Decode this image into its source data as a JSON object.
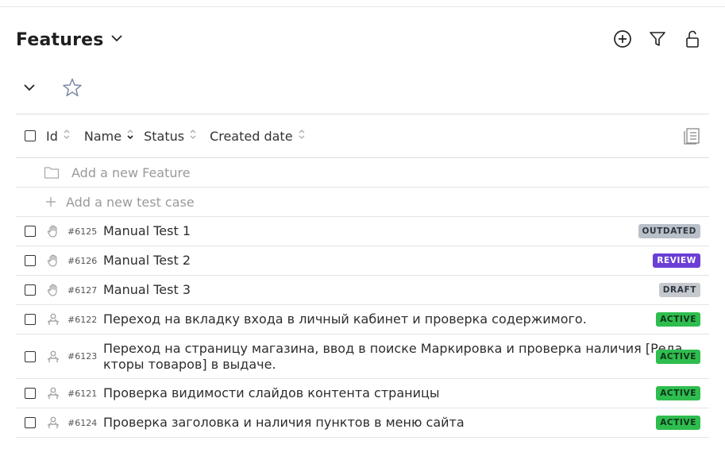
{
  "header": {
    "title": "Features",
    "icons": [
      "chevron-down-icon",
      "plus-circle-icon",
      "filter-icon",
      "unlock-icon"
    ]
  },
  "toolbar": {
    "icons": [
      "chevron-down-icon",
      "star-icon"
    ]
  },
  "table": {
    "columns": [
      "Id",
      "Name",
      "Status",
      "Created date"
    ],
    "add_feature_label": "Add a new Feature",
    "add_test_case_label": "Add a new test case",
    "rows": [
      {
        "id": "#6125",
        "name": "Manual Test 1",
        "status": "OUTDATED",
        "type": "manual"
      },
      {
        "id": "#6126",
        "name": "Manual Test 2",
        "status": "REVIEW",
        "type": "manual"
      },
      {
        "id": "#6127",
        "name": "Manual Test 3",
        "status": "DRAFT",
        "type": "manual"
      },
      {
        "id": "#6122",
        "name": "Переход на вкладку входа в личный кабинет и проверка содержимого.",
        "status": "ACTIVE",
        "type": "automated"
      },
      {
        "id": "#6123",
        "name": "Переход на страницу магазина, ввод в поиске Маркировка и проверка наличия [Реда",
        "name_line2": "кторы товаров] в выдаче.",
        "status": "ACTIVE",
        "type": "automated"
      },
      {
        "id": "#6121",
        "name": "Проверка видимости слайдов контента страницы",
        "status": "ACTIVE",
        "type": "automated"
      },
      {
        "id": "#6124",
        "name": "Проверка заголовка и наличия пунктов в меню сайта",
        "status": "ACTIVE",
        "type": "automated"
      }
    ]
  },
  "colors": {
    "outdated": "#b9c0c8",
    "review": "#6b3fd6",
    "draft": "#c5c9ce",
    "active": "#2ebd4e"
  }
}
